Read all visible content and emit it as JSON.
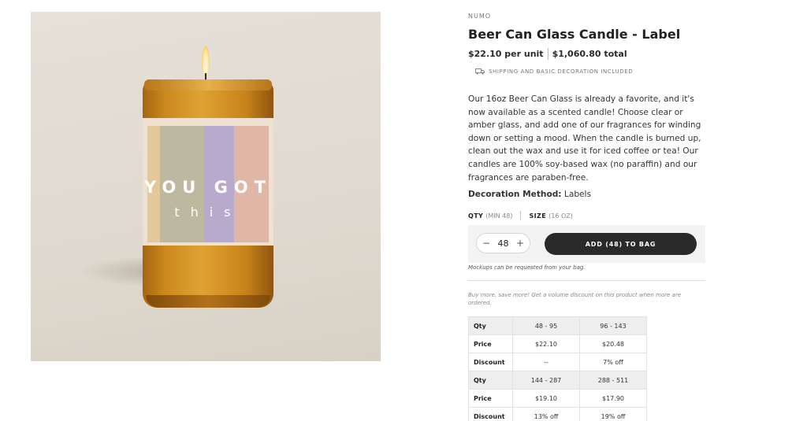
{
  "product": {
    "brand": "NUMO",
    "title": "Beer Can Glass Candle - Label",
    "price_unit": "$22.10 per unit",
    "price_total": "$1,060.80 total",
    "shipping_text": "SHIPPING AND BASIC DECORATION INCLUDED",
    "description": "Our 16oz Beer Can Glass is already a favorite, and it's now available as a scented candle! Choose clear or amber glass, and add one of our fragrances for winding down or setting a mood. When the candle is burned up, clean out the wax and use it for iced coffee or tea! Our candles are 100% soy-based wax (no paraffin) and our fragrances are paraben-free.",
    "decoration_label": "Decoration Method:",
    "decoration_value": "Labels"
  },
  "image": {
    "label_line1": "YOU GOT",
    "label_line2": "this"
  },
  "options": {
    "qty_label": "QTY",
    "qty_min": "(MIN 48)",
    "size_label": "SIZE",
    "size_value": "(16 OZ)"
  },
  "buy": {
    "minus": "−",
    "plus": "+",
    "quantity": "48",
    "add_button": "ADD (48) TO BAG",
    "mockup_note": "Mockups can be requested from your bag."
  },
  "volume": {
    "note": "Buy more, save more! Get a volume discount on this product when more are ordered.",
    "rows": [
      {
        "header": "Qty",
        "values": [
          "48 - 95",
          "96 - 143"
        ],
        "type": "qty"
      },
      {
        "header": "Price",
        "values": [
          "$22.10",
          "$20.48"
        ],
        "type": "price"
      },
      {
        "header": "Discount",
        "values": [
          "--",
          "7% off"
        ],
        "type": "discount"
      },
      {
        "header": "Qty",
        "values": [
          "144 - 287",
          "288 - 511"
        ],
        "type": "qty"
      },
      {
        "header": "Price",
        "values": [
          "$19.10",
          "$17.90"
        ],
        "type": "price"
      },
      {
        "header": "Discount",
        "values": [
          "13% off",
          "19% off"
        ],
        "type": "discount"
      }
    ]
  },
  "colors": {
    "button_bg": "#2a2a2a",
    "buy_box_bg": "#f3f3f3",
    "amber_glass": "#cc8a1e"
  },
  "icons": {
    "shipping": "truck-icon"
  }
}
